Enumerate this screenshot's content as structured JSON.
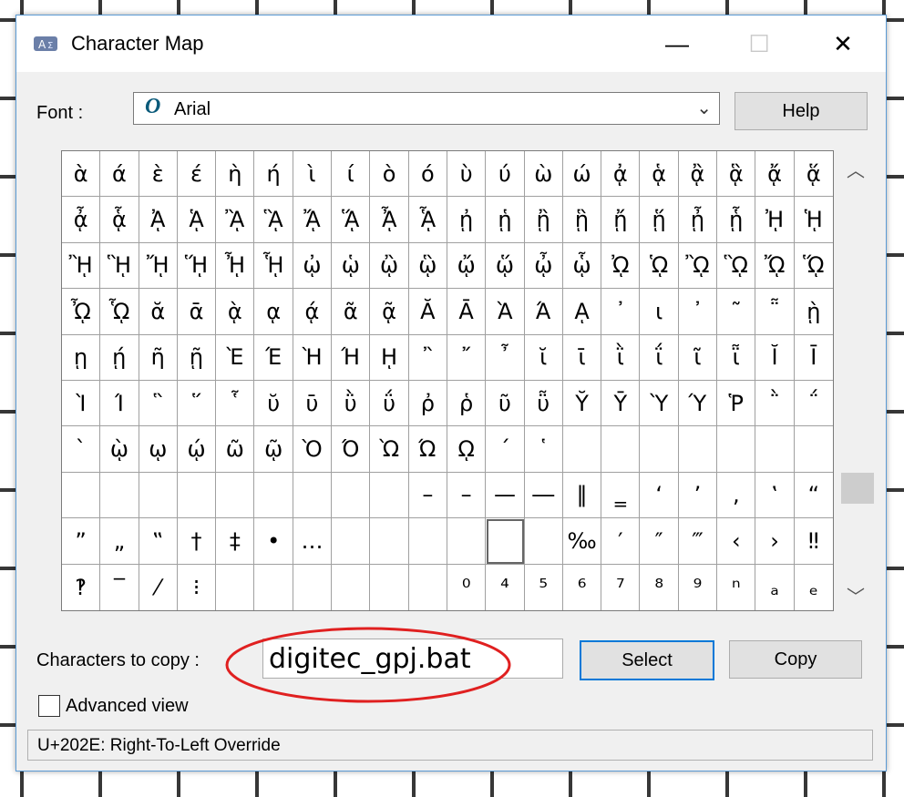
{
  "window": {
    "title": "Character Map"
  },
  "titlebar": {
    "minimize": "—",
    "maximize": "☐",
    "close": "✕"
  },
  "font": {
    "label": "Font :",
    "value": "Arial",
    "icon_glyph": "O"
  },
  "help_button": {
    "label": "Help"
  },
  "characters": [
    [
      "ὰ",
      "ά",
      "ὲ",
      "έ",
      "ὴ",
      "ή",
      "ὶ",
      "ί",
      "ὸ",
      "ό",
      "ὺ",
      "ύ",
      "ὼ",
      "ώ",
      "ᾀ",
      "ᾁ",
      "ᾂ",
      "ᾃ",
      "ᾄ",
      "ᾅ"
    ],
    [
      "ᾆ",
      "ᾇ",
      "ᾈ",
      "ᾉ",
      "ᾊ",
      "ᾋ",
      "ᾌ",
      "ᾍ",
      "ᾎ",
      "ᾏ",
      "ᾐ",
      "ᾑ",
      "ᾒ",
      "ᾓ",
      "ᾔ",
      "ᾕ",
      "ᾖ",
      "ᾗ",
      "ᾘ",
      "ᾙ"
    ],
    [
      "ᾚ",
      "ᾛ",
      "ᾜ",
      "ᾝ",
      "ᾞ",
      "ᾟ",
      "ᾠ",
      "ᾡ",
      "ᾢ",
      "ᾣ",
      "ᾤ",
      "ᾥ",
      "ᾦ",
      "ᾧ",
      "ᾨ",
      "ᾩ",
      "ᾪ",
      "ᾫ",
      "ᾬ",
      "ᾭ"
    ],
    [
      "ᾮ",
      "ᾯ",
      "ᾰ",
      "ᾱ",
      "ᾲ",
      "ᾳ",
      "ᾴ",
      "ᾶ",
      "ᾷ",
      "Ᾰ",
      "Ᾱ",
      "Ὰ",
      "Ά",
      "ᾼ",
      "᾽",
      "ι",
      "᾿",
      "῀",
      "῁",
      "ῂ"
    ],
    [
      "ῃ",
      "ῄ",
      "ῆ",
      "ῇ",
      "Ὲ",
      "Έ",
      "Ὴ",
      "Ή",
      "ῌ",
      "῍",
      "῎",
      "῏",
      "ῐ",
      "ῑ",
      "ῒ",
      "ΐ",
      "ῖ",
      "ῗ",
      "Ῐ",
      "Ῑ"
    ],
    [
      "Ὶ",
      "Ί",
      "῝",
      "῞",
      "῟",
      "ῠ",
      "ῡ",
      "ῢ",
      "ΰ",
      "ῤ",
      "ῥ",
      "ῦ",
      "ῧ",
      "Ῠ",
      "Ῡ",
      "Ὺ",
      "Ύ",
      "Ῥ",
      "῭",
      "΅"
    ],
    [
      "`",
      "ῲ",
      "ῳ",
      "ῴ",
      "ῶ",
      "ῷ",
      "Ὸ",
      "Ό",
      "Ὼ",
      "Ώ",
      "ῼ",
      "´",
      "῾",
      "",
      "",
      "",
      "",
      "",
      "",
      ""
    ],
    [
      "",
      "",
      "",
      "",
      "",
      "",
      "",
      "",
      "",
      "–",
      "–",
      "—",
      "―",
      "‖",
      "‗",
      "‘",
      "’",
      "‚",
      "‛",
      "“"
    ],
    [
      "”",
      "„",
      "‟",
      "†",
      "‡",
      "•",
      "…",
      "",
      "",
      "",
      "",
      "",
      "",
      "‰",
      "′",
      "″",
      "‴",
      "‹",
      "›",
      "‼"
    ],
    [
      "‽",
      "‾",
      "⁄",
      "⁝",
      "",
      "",
      "",
      "",
      "",
      "",
      "⁰",
      "⁴",
      "⁵",
      "⁶",
      "⁷",
      "⁸",
      "⁹",
      "ⁿ",
      "ₐ",
      "ₑ"
    ]
  ],
  "selected_cell": {
    "row": 8,
    "col": 11
  },
  "copy": {
    "label": "Characters to copy :",
    "value": "digitec_gpj.bat"
  },
  "select_button": {
    "label": "Select"
  },
  "copy_button": {
    "label": "Copy"
  },
  "advanced_view": {
    "label": "Advanced view",
    "checked": false
  },
  "status": {
    "text": "U+202E: Right-To-Left Override"
  },
  "annotation": {
    "color": "#e02020"
  }
}
